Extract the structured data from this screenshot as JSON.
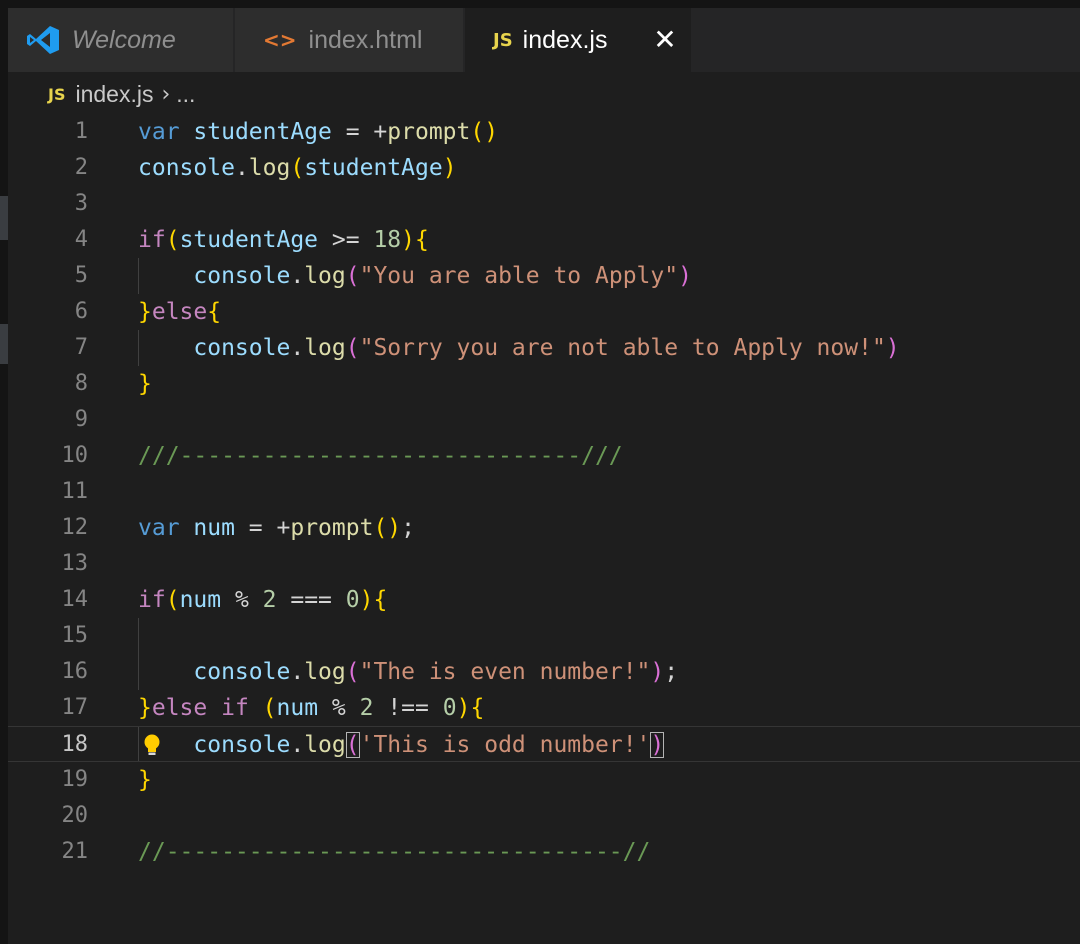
{
  "tabs": {
    "welcome": "Welcome",
    "html": "index.html",
    "js": "index.js",
    "js_badge": "JS",
    "close_glyph": "✕"
  },
  "breadcrumb": {
    "badge": "JS",
    "file": "index.js",
    "separator": "›",
    "rest": "..."
  },
  "icons": {
    "vscode": "vscode-logo-icon",
    "html": "code-brackets-icon",
    "js": "js-file-icon",
    "close": "close-icon",
    "bulb": "lightbulb-icon"
  },
  "colors": {
    "background": "#1e1e1e",
    "keyword": "#569cd6",
    "string": "#ce9178",
    "comment": "#6a9955",
    "function": "#dcdcaa",
    "variable": "#9cdcfe",
    "number": "#b5cea8",
    "bracket_gold": "#ffd700",
    "bracket_purple": "#da70d6",
    "bracket_blue": "#179fff"
  },
  "editor": {
    "current_line": 18,
    "lines": [
      {
        "n": "1",
        "t": [
          {
            "c": "kw",
            "s": "var"
          },
          {
            "c": "plain",
            "s": " "
          },
          {
            "c": "var",
            "s": "studentAge"
          },
          {
            "c": "plain",
            "s": " = +"
          },
          {
            "c": "fn",
            "s": "prompt"
          },
          {
            "c": "b1",
            "s": "()"
          }
        ]
      },
      {
        "n": "2",
        "t": [
          {
            "c": "var",
            "s": "console"
          },
          {
            "c": "plain",
            "s": "."
          },
          {
            "c": "fn",
            "s": "log"
          },
          {
            "c": "b1",
            "s": "("
          },
          {
            "c": "var",
            "s": "studentAge"
          },
          {
            "c": "b1",
            "s": ")"
          }
        ]
      },
      {
        "n": "3",
        "t": []
      },
      {
        "n": "4",
        "t": [
          {
            "c": "ctl",
            "s": "if"
          },
          {
            "c": "b1",
            "s": "("
          },
          {
            "c": "var",
            "s": "studentAge"
          },
          {
            "c": "plain",
            "s": " >= "
          },
          {
            "c": "num",
            "s": "18"
          },
          {
            "c": "b1",
            "s": ")"
          },
          {
            "c": "b1",
            "s": "{"
          }
        ]
      },
      {
        "n": "5",
        "t": [
          {
            "c": "plain",
            "s": "    "
          },
          {
            "c": "var",
            "s": "console"
          },
          {
            "c": "plain",
            "s": "."
          },
          {
            "c": "fn",
            "s": "log"
          },
          {
            "c": "b2",
            "s": "("
          },
          {
            "c": "str",
            "s": "\"You are able to Apply\""
          },
          {
            "c": "b2",
            "s": ")"
          }
        ]
      },
      {
        "n": "6",
        "t": [
          {
            "c": "b1",
            "s": "}"
          },
          {
            "c": "ctl",
            "s": "else"
          },
          {
            "c": "b1",
            "s": "{"
          }
        ]
      },
      {
        "n": "7",
        "t": [
          {
            "c": "plain",
            "s": "    "
          },
          {
            "c": "var",
            "s": "console"
          },
          {
            "c": "plain",
            "s": "."
          },
          {
            "c": "fn",
            "s": "log"
          },
          {
            "c": "b2",
            "s": "("
          },
          {
            "c": "str",
            "s": "\"Sorry you are not able to Apply now!\""
          },
          {
            "c": "b2",
            "s": ")"
          }
        ]
      },
      {
        "n": "8",
        "t": [
          {
            "c": "b1",
            "s": "}"
          }
        ]
      },
      {
        "n": "9",
        "t": []
      },
      {
        "n": "10",
        "t": [
          {
            "c": "cmt",
            "s": "///-----------------------------///"
          }
        ]
      },
      {
        "n": "11",
        "t": []
      },
      {
        "n": "12",
        "t": [
          {
            "c": "kw",
            "s": "var"
          },
          {
            "c": "plain",
            "s": " "
          },
          {
            "c": "var",
            "s": "num"
          },
          {
            "c": "plain",
            "s": " = +"
          },
          {
            "c": "fn",
            "s": "prompt"
          },
          {
            "c": "b1",
            "s": "()"
          },
          {
            "c": "plain",
            "s": ";"
          }
        ]
      },
      {
        "n": "13",
        "t": []
      },
      {
        "n": "14",
        "t": [
          {
            "c": "ctl",
            "s": "if"
          },
          {
            "c": "b1",
            "s": "("
          },
          {
            "c": "var",
            "s": "num"
          },
          {
            "c": "plain",
            "s": " % "
          },
          {
            "c": "num",
            "s": "2"
          },
          {
            "c": "plain",
            "s": " === "
          },
          {
            "c": "num",
            "s": "0"
          },
          {
            "c": "b1",
            "s": ")"
          },
          {
            "c": "b1",
            "s": "{"
          }
        ]
      },
      {
        "n": "15",
        "t": []
      },
      {
        "n": "16",
        "t": [
          {
            "c": "plain",
            "s": "    "
          },
          {
            "c": "var",
            "s": "console"
          },
          {
            "c": "plain",
            "s": "."
          },
          {
            "c": "fn",
            "s": "log"
          },
          {
            "c": "b2",
            "s": "("
          },
          {
            "c": "str",
            "s": "\"The is even number!\""
          },
          {
            "c": "b2",
            "s": ")"
          },
          {
            "c": "plain",
            "s": ";"
          }
        ]
      },
      {
        "n": "17",
        "t": [
          {
            "c": "b1",
            "s": "}"
          },
          {
            "c": "ctl",
            "s": "else if"
          },
          {
            "c": "plain",
            "s": " "
          },
          {
            "c": "b1",
            "s": "("
          },
          {
            "c": "var",
            "s": "num"
          },
          {
            "c": "plain",
            "s": " % "
          },
          {
            "c": "num",
            "s": "2"
          },
          {
            "c": "plain",
            "s": " !== "
          },
          {
            "c": "num",
            "s": "0"
          },
          {
            "c": "b1",
            "s": ")"
          },
          {
            "c": "b1",
            "s": "{"
          }
        ]
      },
      {
        "n": "18",
        "t": [
          {
            "c": "plain",
            "s": "    "
          },
          {
            "c": "var",
            "s": "console"
          },
          {
            "c": "plain",
            "s": "."
          },
          {
            "c": "fn",
            "s": "log"
          },
          {
            "c": "b2 bmatch",
            "s": "("
          },
          {
            "c": "str",
            "s": "'This is odd number!'"
          },
          {
            "c": "b2 bmatch",
            "s": ")"
          }
        ]
      },
      {
        "n": "19",
        "t": [
          {
            "c": "b1",
            "s": "}"
          }
        ]
      },
      {
        "n": "20",
        "t": []
      },
      {
        "n": "21",
        "t": [
          {
            "c": "cmt",
            "s": "//---------------------------------//"
          }
        ]
      }
    ]
  }
}
